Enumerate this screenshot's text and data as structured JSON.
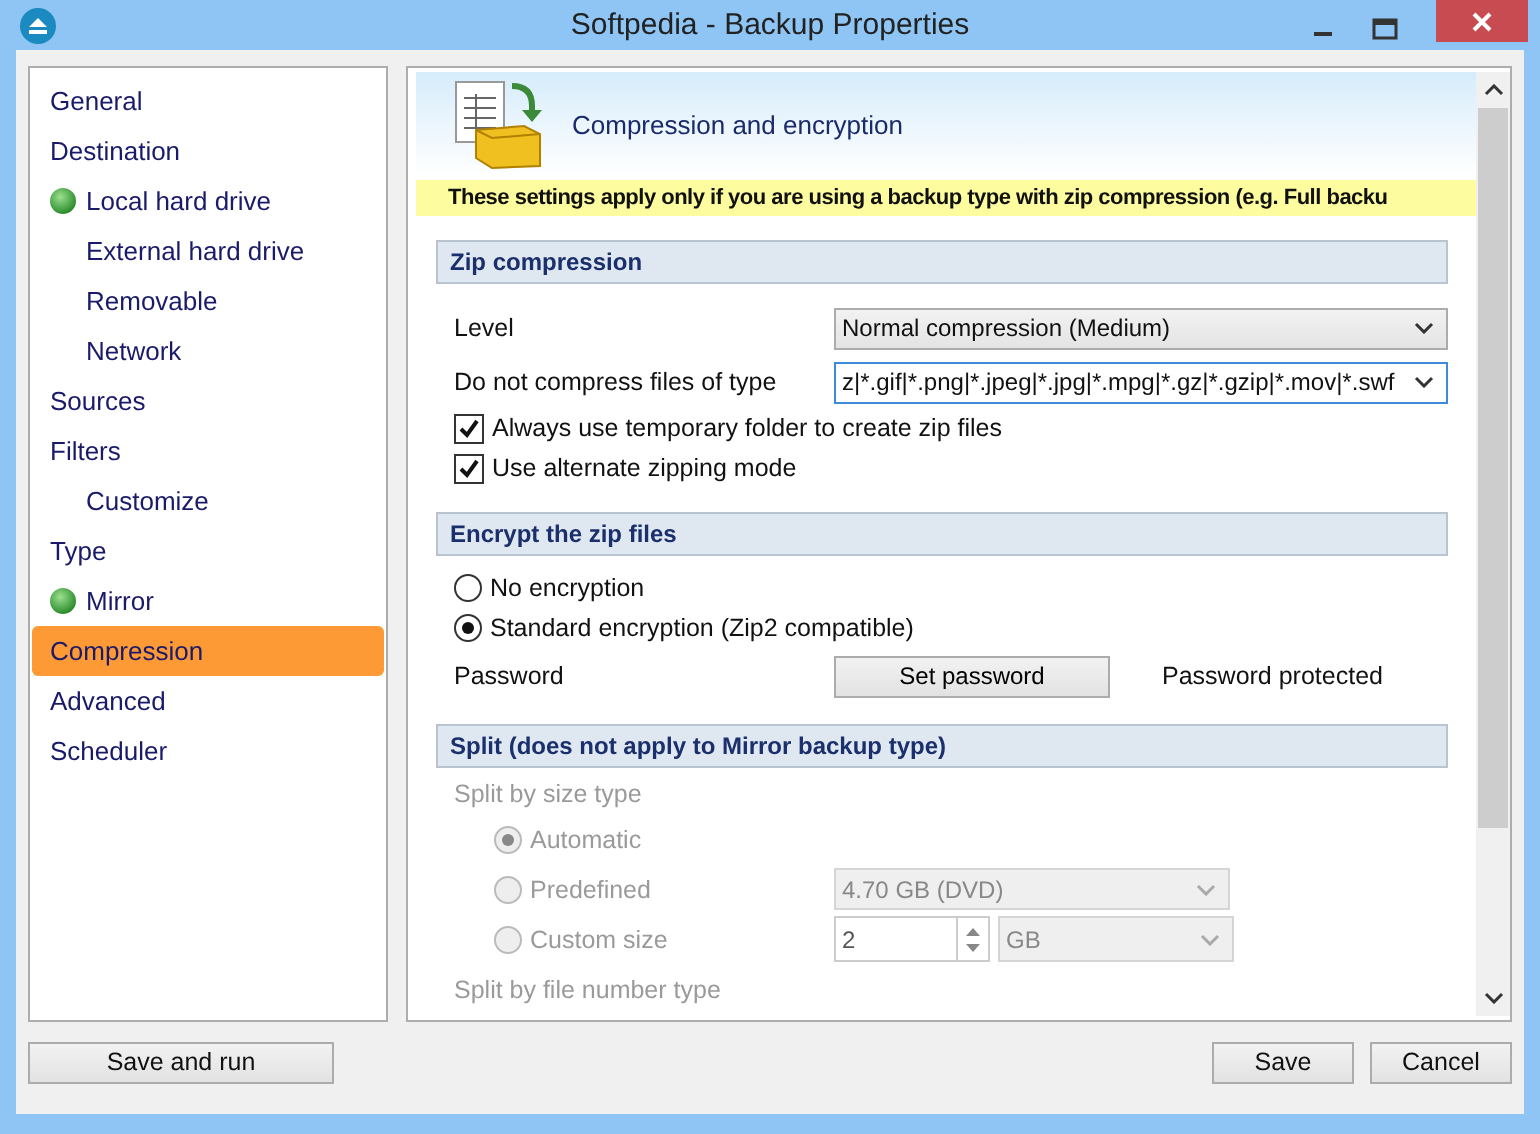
{
  "window": {
    "title": "Softpedia - Backup Properties"
  },
  "sidebar": {
    "items": [
      {
        "label": "General",
        "selected": false,
        "active": false
      },
      {
        "label": "Destination",
        "selected": false,
        "active": false,
        "children": [
          {
            "label": "Local hard drive",
            "selected": false,
            "active": true
          },
          {
            "label": "External hard drive",
            "selected": false,
            "active": false
          },
          {
            "label": "Removable",
            "selected": false,
            "active": false
          },
          {
            "label": "Network",
            "selected": false,
            "active": false
          }
        ]
      },
      {
        "label": "Sources",
        "selected": false,
        "active": false
      },
      {
        "label": "Filters",
        "selected": false,
        "active": false,
        "children": [
          {
            "label": "Customize",
            "selected": false,
            "active": false
          }
        ]
      },
      {
        "label": "Type",
        "selected": false,
        "active": false,
        "children": [
          {
            "label": "Mirror",
            "selected": false,
            "active": true
          }
        ]
      },
      {
        "label": "Compression",
        "selected": true,
        "active": false
      },
      {
        "label": "Advanced",
        "selected": false,
        "active": false
      },
      {
        "label": "Scheduler",
        "selected": false,
        "active": false
      }
    ]
  },
  "page": {
    "title": "Compression and encryption",
    "notice": "These settings apply only if you are using a backup type with zip compression (e.g. Full backu",
    "sections": [
      {
        "title": "Zip compression",
        "rows": [
          {
            "kind": "select",
            "label": "Level",
            "value": "Normal compression (Medium)",
            "focused": false
          },
          {
            "kind": "select",
            "label": "Do not compress files of type",
            "value": "z|*.gif|*.png|*.jpeg|*.jpg|*.mpg|*.gz|*.gzip|*.mov|*.swf",
            "focused": true
          },
          {
            "kind": "checkbox",
            "label": "Always use temporary folder to create zip files",
            "checked": true,
            "disabled": false
          },
          {
            "kind": "checkbox",
            "label": "Use alternate zipping mode",
            "checked": true,
            "disabled": false
          }
        ]
      },
      {
        "title": "Encrypt the zip files",
        "rows": [
          {
            "kind": "radio",
            "label": "No encryption",
            "selected": false,
            "disabled": false
          },
          {
            "kind": "radio",
            "label": "Standard encryption (Zip2 compatible)",
            "selected": true,
            "disabled": false
          },
          {
            "kind": "action",
            "label": "Password",
            "button": "Set password",
            "status": "Password protected"
          }
        ]
      },
      {
        "title": "Split (does not apply to Mirror backup type)",
        "rows": [
          {
            "kind": "caption",
            "label": "Split by size type",
            "disabled": true,
            "children": [
              {
                "kind": "radio",
                "label": "Automatic",
                "selected": true,
                "disabled": true
              },
              {
                "kind": "radio-select",
                "label": "Predefined",
                "selected": false,
                "disabled": true,
                "value": "4.70 GB (DVD)"
              },
              {
                "kind": "radio-spin",
                "label": "Custom size",
                "selected": false,
                "disabled": true,
                "value": "2",
                "unit": "GB"
              }
            ]
          },
          {
            "kind": "caption",
            "label": "Split by file number type",
            "disabled": true
          }
        ]
      }
    ]
  },
  "footer": {
    "left": [
      "Save and run"
    ],
    "right": [
      "Save",
      "Cancel"
    ]
  }
}
